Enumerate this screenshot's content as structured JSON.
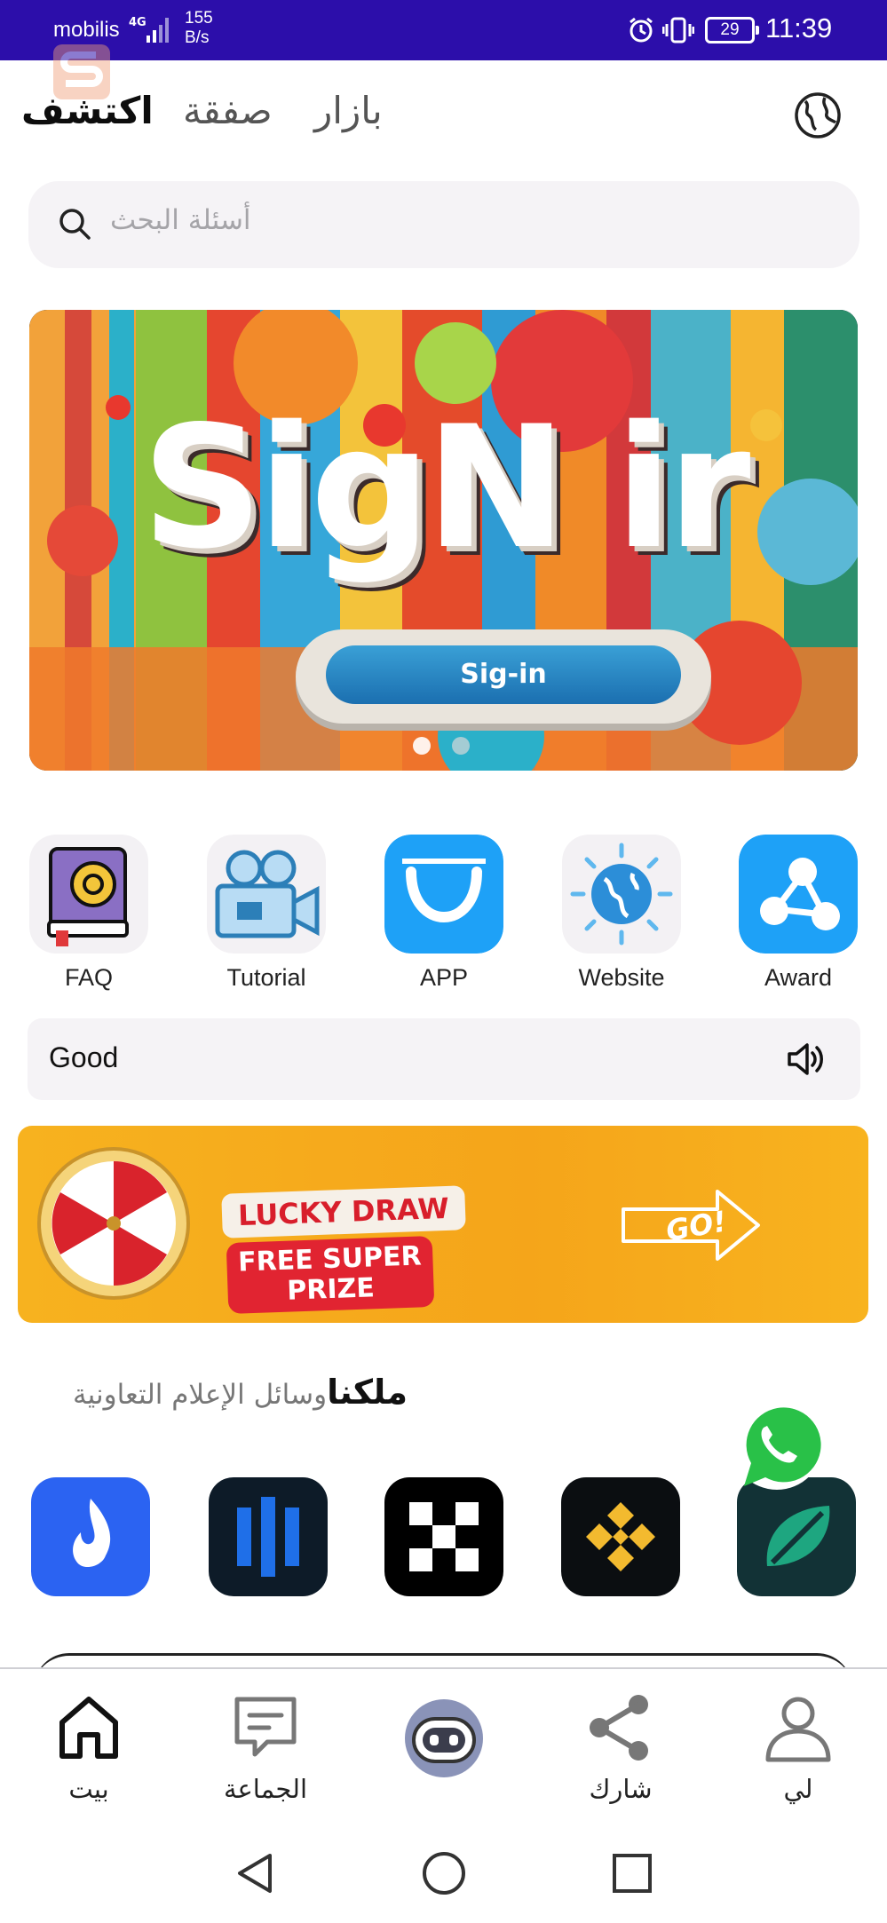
{
  "status_bar": {
    "carrier": "mobilis",
    "network": "4G",
    "speed": "155\nB/s",
    "battery": "29",
    "time": "11:39"
  },
  "header": {
    "tabs": [
      {
        "label": "اكتشف",
        "active": true
      },
      {
        "label": "صفقة",
        "active": false
      },
      {
        "label": "بازار",
        "active": false
      }
    ],
    "globe_icon": "globe-icon"
  },
  "search": {
    "placeholder": "أسئلة البحث"
  },
  "banner": {
    "title": "SigN ir",
    "button_label": "Sig-in",
    "active_slide": 1,
    "slide_count": 2
  },
  "quick_links": [
    {
      "label": "FAQ",
      "icon": "book-icon"
    },
    {
      "label": "Tutorial",
      "icon": "video-camera-icon"
    },
    {
      "label": "APP",
      "icon": "shopping-bag-icon"
    },
    {
      "label": "Website",
      "icon": "globe-network-icon"
    },
    {
      "label": "Award",
      "icon": "share-nodes-icon"
    }
  ],
  "notice": {
    "text": "Good",
    "icon": "speaker-icon"
  },
  "lucky_draw": {
    "line1": "LUCKY DRAW",
    "line2": "FREE SUPER PRIZE",
    "go": "GO!"
  },
  "media_section": {
    "bold": "ملكنا",
    "light": "وسائل الإعلام التعاونية"
  },
  "partners": [
    {
      "name": "huobi-logo",
      "bg": "#2b63f2"
    },
    {
      "name": "bar-logo",
      "bg": "#0d1b28"
    },
    {
      "name": "okx-logo",
      "bg": "#000000"
    },
    {
      "name": "binance-logo",
      "bg": "#0b0e11"
    },
    {
      "name": "bitget-logo",
      "bg": "#123236"
    }
  ],
  "bottom_nav": [
    {
      "label": "بيت",
      "icon": "home-icon"
    },
    {
      "label": "الجماعة",
      "icon": "chat-icon"
    },
    {
      "label": "",
      "icon": "robot-icon"
    },
    {
      "label": "شارك",
      "icon": "share-icon"
    },
    {
      "label": "لي",
      "icon": "user-icon"
    }
  ],
  "colors": {
    "status_bar": "#2c0eaa",
    "accent_blue": "#1ea1f7",
    "search_bg": "#f5f3f6"
  }
}
